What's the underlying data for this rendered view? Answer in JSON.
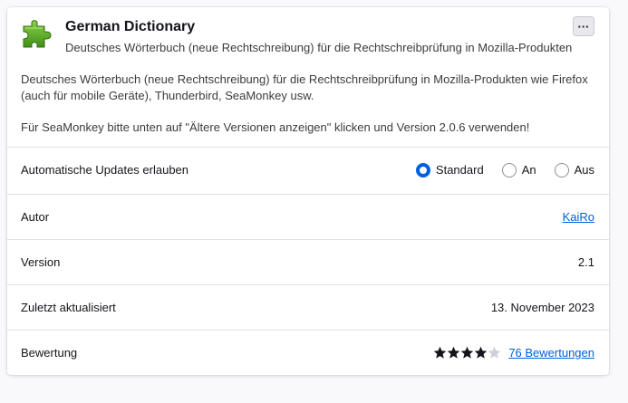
{
  "addon": {
    "name": "German Dictionary",
    "summary": "Deutsches Wörterbuch (neue Rechtschreibung) für die Rechtschreibprüfung in Mozilla-Produkten",
    "icon": "puzzle-piece-icon",
    "icon_color": "#58a81e",
    "more_button_label": "···"
  },
  "description": {
    "paragraph1": "Deutsches Wörterbuch (neue Rechtschreibung) für die Rechtschreibprüfung in Mozilla-Produkten wie Firefox (auch für mobile Geräte), Thunderbird, SeaMonkey usw.",
    "paragraph2": "Für SeaMonkey bitte unten auf \"Ältere Versionen anzeigen\" klicken und Version 2.0.6 verwenden!"
  },
  "updates": {
    "label": "Automatische Updates erlauben",
    "options": [
      {
        "label": "Standard",
        "selected": true
      },
      {
        "label": "An",
        "selected": false
      },
      {
        "label": "Aus",
        "selected": false
      }
    ]
  },
  "author": {
    "label": "Autor",
    "value": "KaiRo"
  },
  "version": {
    "label": "Version",
    "value": "2.1"
  },
  "last_updated": {
    "label": "Zuletzt aktualisiert",
    "value": "13. November 2023"
  },
  "rating": {
    "label": "Bewertung",
    "stars": 4,
    "max_stars": 5,
    "reviews_link": "76 Bewertungen"
  },
  "colors": {
    "accent": "#0061e0",
    "star_filled": "#15141a",
    "star_empty": "#cfcfd8"
  }
}
